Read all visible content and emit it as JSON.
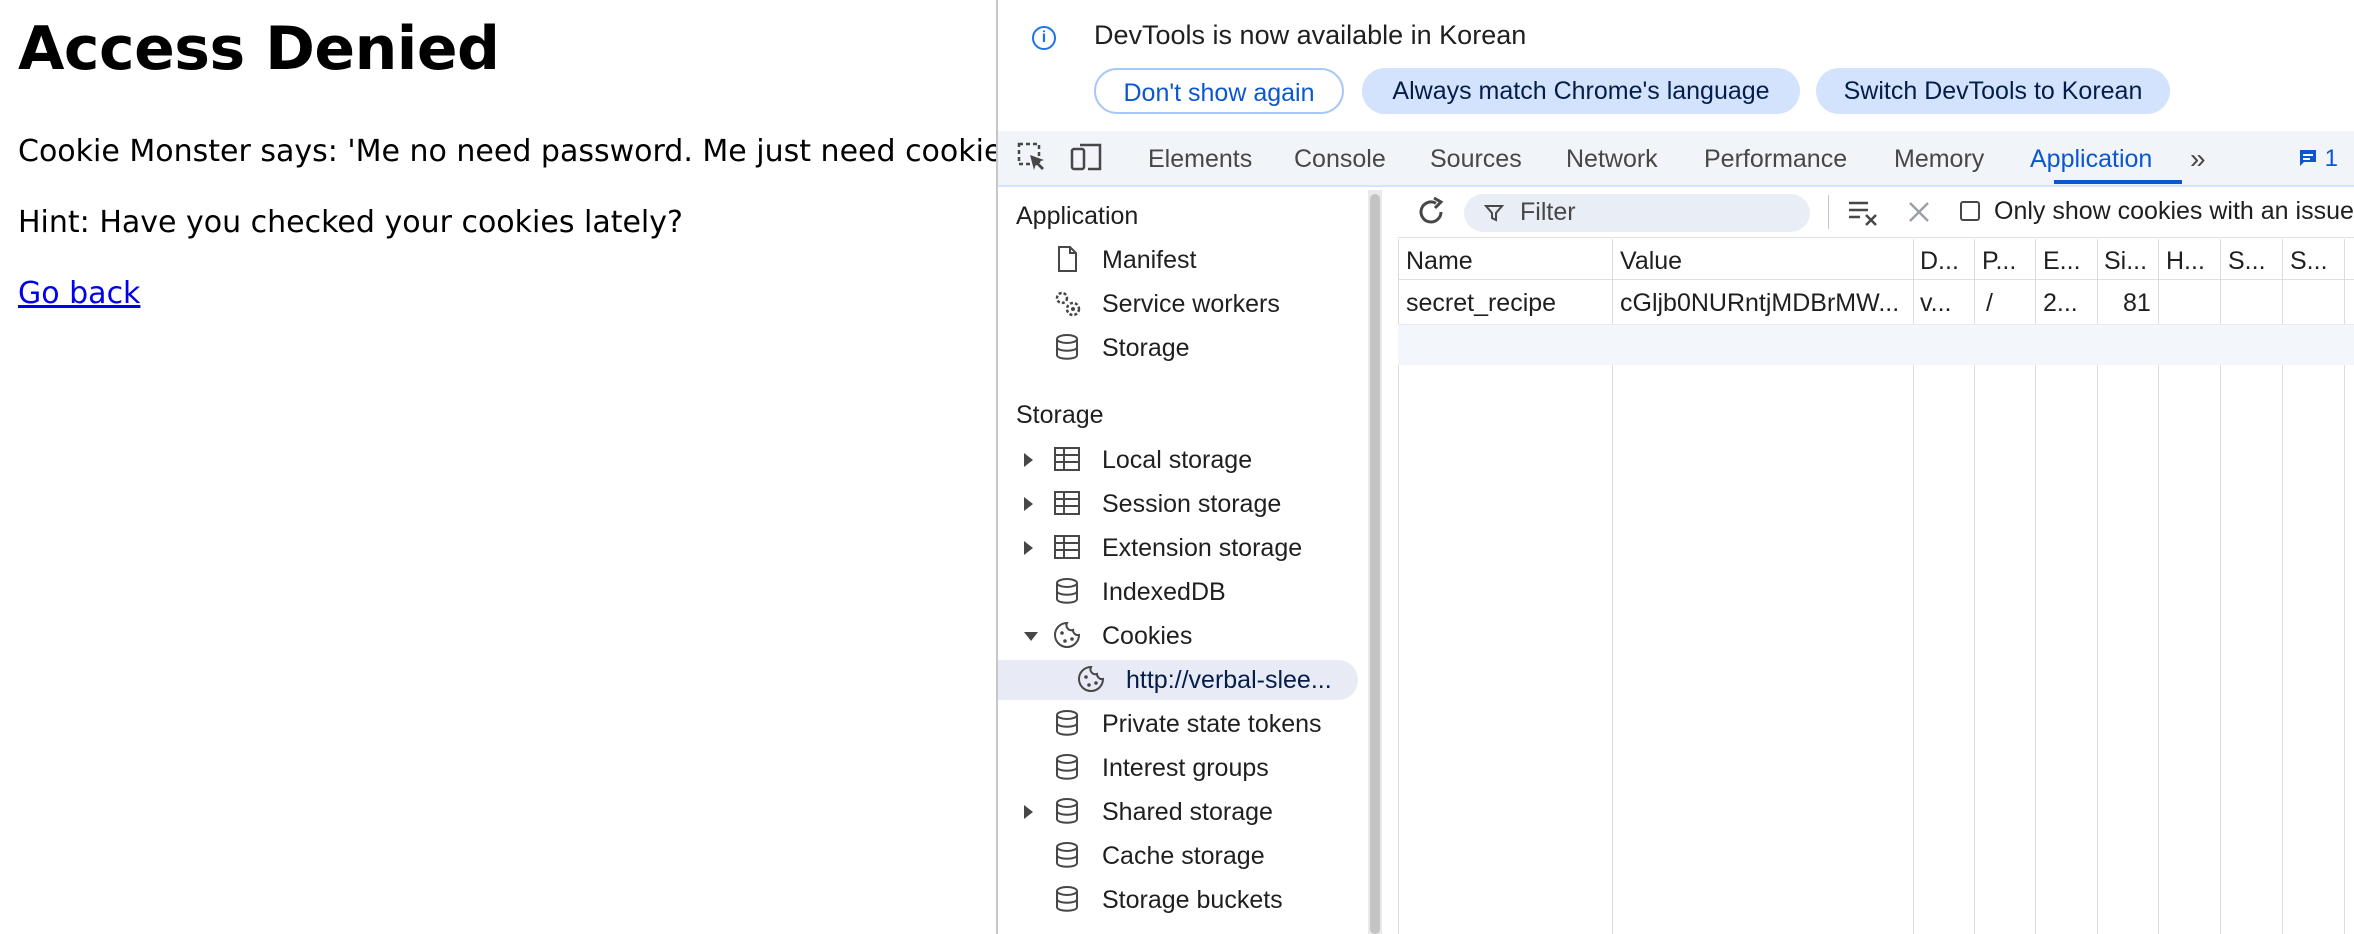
{
  "page": {
    "heading": "Access Denied",
    "line1": "Cookie Monster says: 'Me no need password. Me just need cookies!'",
    "line2": "Hint: Have you checked your cookies lately?",
    "link": "Go back"
  },
  "devtools": {
    "infobar": {
      "message": "DevTools is now available in Korean",
      "btn_dont_show": "Don't show again",
      "btn_match": "Always match Chrome's language",
      "btn_switch": "Switch DevTools to Korean"
    },
    "tabs": [
      "Elements",
      "Console",
      "Sources",
      "Network",
      "Performance",
      "Memory",
      "Application"
    ],
    "active_tab": "Application",
    "issues_count": "1",
    "sidebar": {
      "application_title": "Application",
      "application_items": [
        "Manifest",
        "Service workers",
        "Storage"
      ],
      "storage_title": "Storage",
      "storage_items": [
        "Local storage",
        "Session storage",
        "Extension storage",
        "IndexedDB",
        "Cookies",
        "http://verbal-slee...",
        "Private state tokens",
        "Interest groups",
        "Shared storage",
        "Cache storage",
        "Storage buckets"
      ]
    },
    "cookies": {
      "filter_placeholder": "Filter",
      "only_show_label": "Only show cookies with an issue",
      "columns": [
        "Name",
        "Value",
        "D...",
        "P...",
        "E...",
        "Si...",
        "H...",
        "S...",
        "S..."
      ],
      "rows": [
        [
          "secret_recipe",
          "cGljb0NURntjMDBrMW...",
          "v...",
          "/",
          "2...",
          "81",
          "",
          "",
          ""
        ]
      ]
    },
    "colors": {
      "accent": "#0b57d0",
      "tab_bar_bg": "#f1f4f9",
      "tonal_button_bg": "#d3e3fd"
    }
  }
}
